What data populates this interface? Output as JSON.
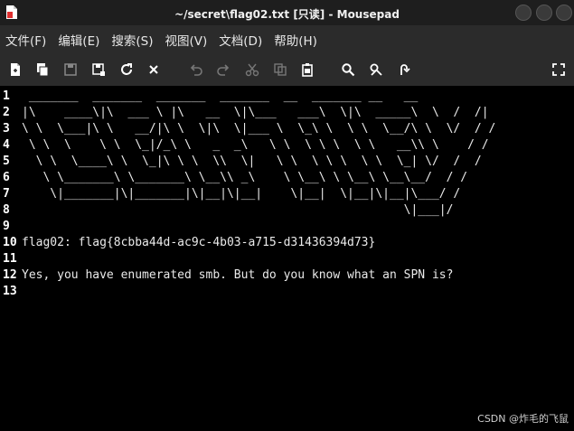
{
  "window": {
    "title": "~/secret\\flag02.txt [只读] - Mousepad"
  },
  "menu": [
    "文件(F)",
    "编辑(E)",
    "搜索(S)",
    "视图(V)",
    "文档(D)",
    "帮助(H)"
  ],
  "toolbar_icons": [
    "new-document-icon",
    "new-window-icon",
    "save-icon",
    "save-as-icon",
    "reload-icon",
    "close-icon",
    "undo-icon",
    "redo-icon",
    "cut-icon",
    "copy-icon",
    "paste-icon",
    "find-icon",
    "find-replace-icon",
    "go-to-line-icon",
    "fullscreen-icon"
  ],
  "lines": [
    " _______  _______  _______  _______  __  _______ __   __",
    "|\\    ____\\|\\  ___ \\ |\\   __  \\|\\___   ___\\  \\|\\  _____\\  \\  /  /|",
    "\\ \\  \\___|\\ \\   __/|\\ \\  \\|\\  \\|___ \\  \\_\\ \\  \\ \\  \\__/\\ \\  \\/  / /",
    " \\ \\  \\    \\ \\  \\_|/_\\ \\   _  _\\   \\ \\  \\ \\ \\  \\ \\   __\\\\ \\    / /",
    "  \\ \\  \\____\\ \\  \\_|\\ \\ \\  \\\\  \\|   \\ \\  \\ \\ \\  \\ \\  \\_| \\/  /  /",
    "   \\ \\_______\\ \\_______\\ \\__\\\\ _\\    \\ \\__\\ \\ \\__\\ \\__\\__/  / /",
    "    \\|_______|\\|_______|\\|__|\\|__|    \\|__|  \\|__|\\|__|\\___/ /",
    "                                                      \\|___|/",
    "",
    "flag02: flag{8cbba44d-ac9c-4b03-a715-d31436394d73}",
    "",
    "Yes, you have enumerated smb. But do you know what an SPN is?",
    ""
  ],
  "line_numbers": [
    "1",
    "2",
    "3",
    "4",
    "5",
    "6",
    "7",
    "8",
    "9",
    "10",
    "11",
    "12",
    "13"
  ],
  "watermark": "CSDN @炸毛的飞鼠"
}
